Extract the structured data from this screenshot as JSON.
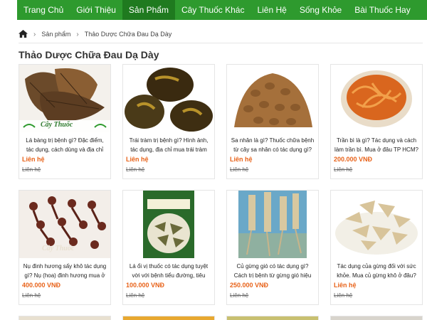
{
  "nav": {
    "items": [
      "Trang Chủ",
      "Giới Thiệu",
      "Sản Phẩm",
      "Cây Thuốc Khác",
      "Liên Hệ",
      "Sống Khỏe",
      "Bài Thuốc Hay"
    ],
    "active_index": 2
  },
  "breadcrumb": {
    "home_icon": "home-icon",
    "items": [
      "Sản phẩm",
      "Thảo Dược Chữa Đau Dạ Dày"
    ]
  },
  "page_title": "Thảo Dược Chữa Đau Dạ Dày",
  "products": [
    {
      "name": "Lá bàng trị bệnh gì? Đặc điểm, tác dụng, cách dùng và địa chỉ",
      "price": "Liên hệ",
      "old_price": "Liên hệ",
      "watermark": "Cây Thuốc"
    },
    {
      "name": "Trái tràm trị bệnh gì? Hình ảnh, tác dụng, địa chỉ mua trái tràm",
      "price": "Liên hệ",
      "old_price": "Liên hệ"
    },
    {
      "name": "Sa nhân là gì? Thuốc chữa bệnh từ cây sa nhân có tác dụng gì?",
      "price": "Liên hệ",
      "old_price": "Liên hệ"
    },
    {
      "name": "Trần bì là gì? Tác dụng và cách làm trần bì. Mua ở đâu TP HCM?",
      "price": "200.000 VNĐ",
      "old_price": "Liên hệ"
    },
    {
      "name": "Nụ đinh hương sấy khô tác dụng gì? Nụ (hoa) đinh hương mua ở",
      "price": "400.000 VNĐ",
      "old_price": "Liên hệ",
      "watermark": "Cây Thuốc"
    },
    {
      "name": "Lá ổi vị thuốc có tác dụng tuyệt vời với bệnh tiểu đường, tiêu",
      "price": "100.000 VNĐ",
      "old_price": "Liên hệ"
    },
    {
      "name": "Củ gừng gió có tác dụng gì? Cách trị bệnh từ gừng gió hiệu",
      "price": "250.000 VNĐ",
      "old_price": "Liên hệ"
    },
    {
      "name": "Tác dụng của gừng đối với sức khỏe. Mua củ gừng khô ở đâu?",
      "price": "Liên hệ",
      "old_price": "Liên hệ"
    }
  ],
  "colors": {
    "nav_bg": "#2e9a2e",
    "nav_active": "#1f7a1f",
    "price": "#e8631a"
  }
}
